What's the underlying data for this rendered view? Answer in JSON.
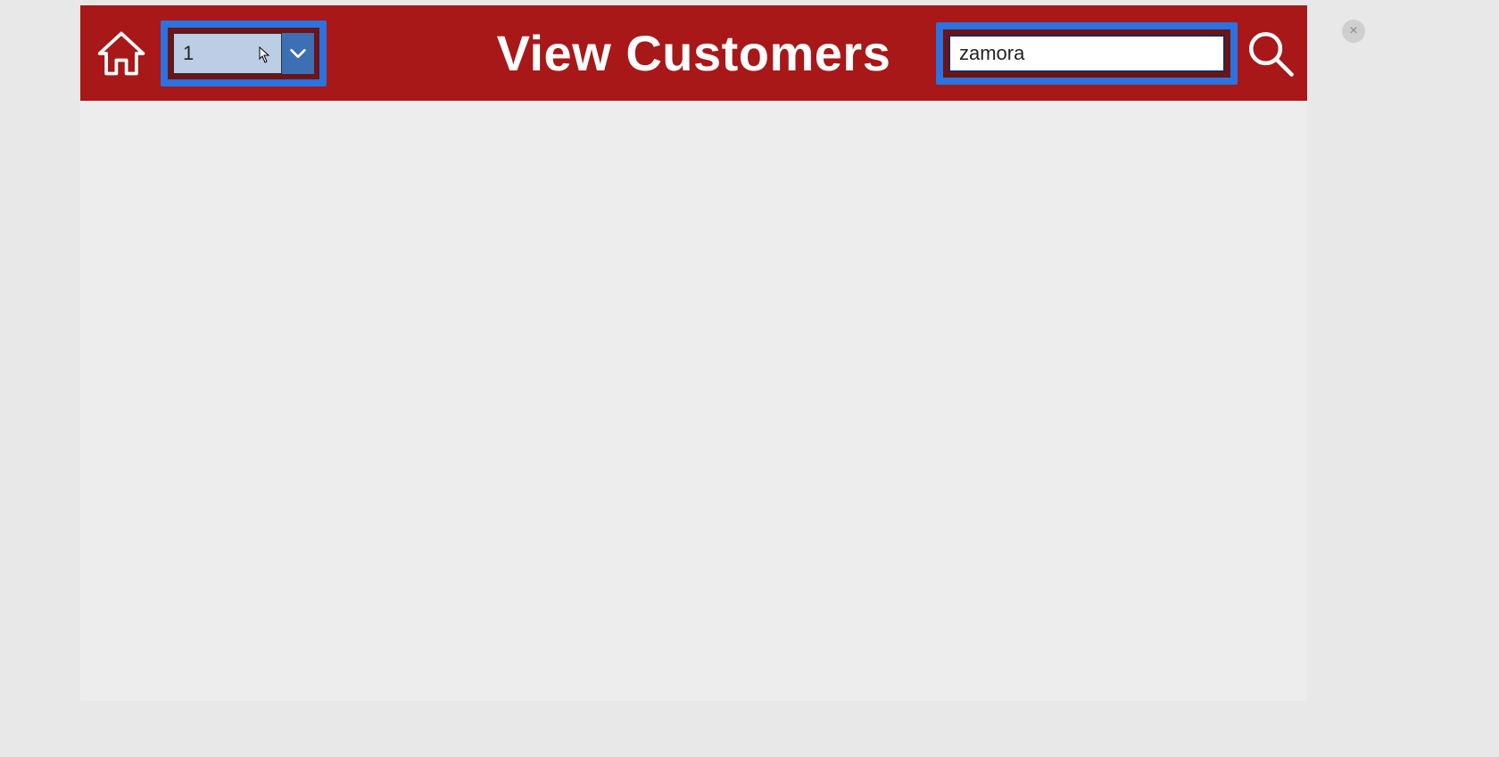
{
  "header": {
    "title": "View Customers",
    "dropdown": {
      "value": "1"
    },
    "search": {
      "value": "zamora"
    }
  },
  "icons": {
    "home": "home-icon",
    "chevron_down": "chevron-down-icon",
    "search": "search-icon",
    "close": "close-icon",
    "cursor": "cursor-icon"
  },
  "close_label": "×"
}
